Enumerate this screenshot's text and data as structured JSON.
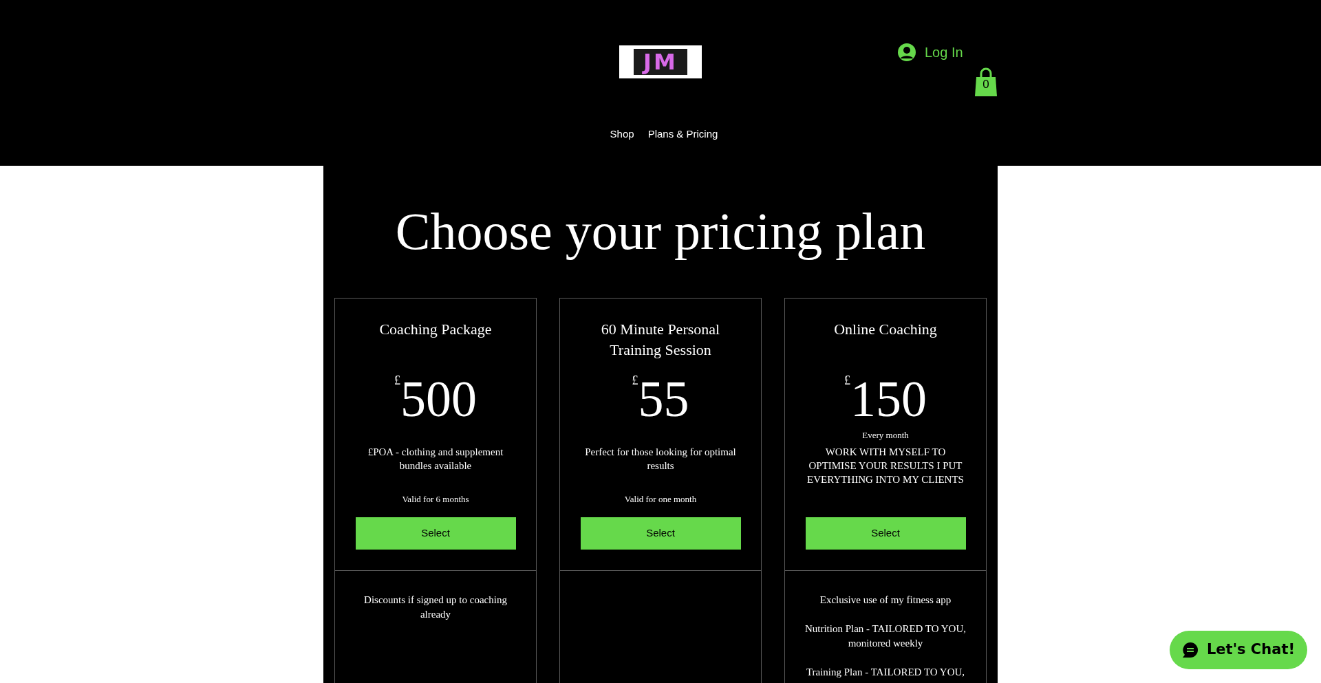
{
  "header": {
    "logo": {
      "text": "JM"
    },
    "login": {
      "label": "Log In"
    },
    "cart": {
      "count": "0"
    },
    "nav": [
      {
        "label": "Shop"
      },
      {
        "label": "Plans & Pricing"
      }
    ]
  },
  "title": "Choose your pricing plan",
  "plans": [
    {
      "name": "Coaching Package",
      "currency": "£",
      "price": "500",
      "description": "£POA - clothing and supplement bundles available",
      "validity": "Valid for 6 months",
      "button": "Select",
      "features": [
        "Discounts if signed up to coaching already"
      ]
    },
    {
      "name": "60 Minute Personal Training Session",
      "currency": "£",
      "price": "55",
      "description": "Perfect for those looking for optimal results",
      "validity": "Valid for one month",
      "button": "Select"
    },
    {
      "name": "Online Coaching",
      "currency": "£",
      "price": "150",
      "period": "Every month",
      "description": "WORK WITH MYSELF TO OPTIMISE YOUR RESULTS I PUT EVERYTHING INTO MY CLIENTS",
      "button": "Select",
      "features": [
        "Exclusive use of my fitness app",
        "Nutrition Plan - TAILORED TO YOU, monitored weekly",
        "Training Plan - TAILORED TO YOU,"
      ]
    }
  ],
  "chat": {
    "label": "Let's Chat!"
  }
}
